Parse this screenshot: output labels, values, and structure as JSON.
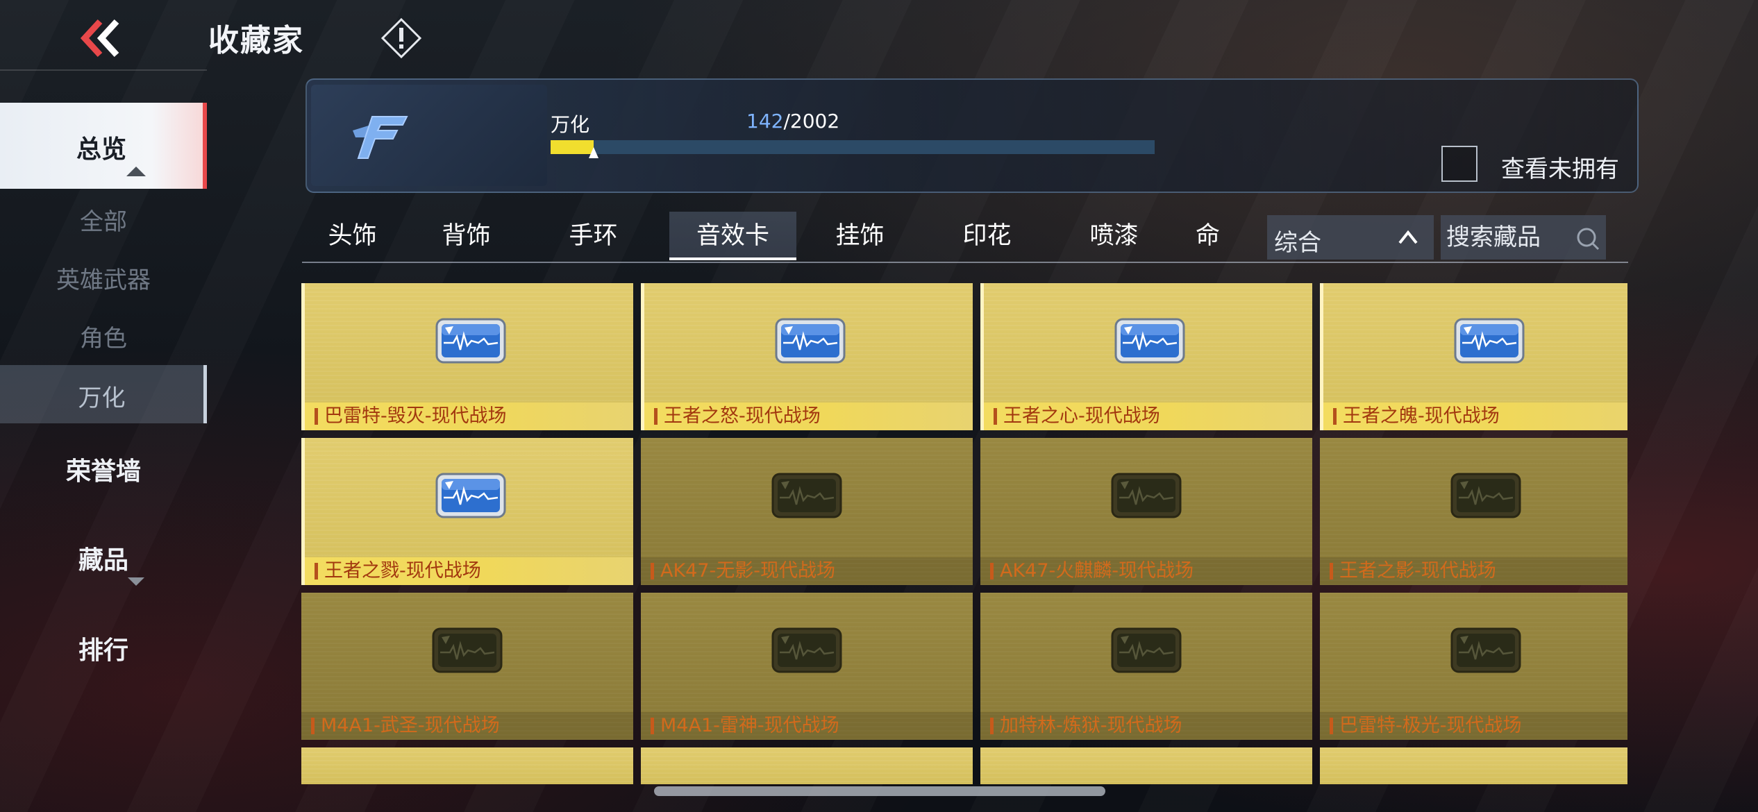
{
  "header": {
    "title": "收藏家"
  },
  "sidebar": {
    "overview_label": "总览",
    "sub_items": [
      {
        "label": "全部"
      },
      {
        "label": "英雄武器"
      },
      {
        "label": "角色"
      },
      {
        "label": "万化"
      }
    ],
    "selected_sub": "万化",
    "main_items": [
      {
        "label": "荣誉墙"
      },
      {
        "label": "藏品"
      },
      {
        "label": "排行"
      }
    ]
  },
  "progress": {
    "label": "万化",
    "current": "142",
    "total": "/2002",
    "fraction": 0.071
  },
  "owned_filter": {
    "label": "查看未拥有",
    "checked": false
  },
  "tabs": [
    {
      "label": "头饰"
    },
    {
      "label": "背饰"
    },
    {
      "label": "手环"
    },
    {
      "label": "音效卡"
    },
    {
      "label": "挂饰"
    },
    {
      "label": "印花"
    },
    {
      "label": "喷漆"
    },
    {
      "label": "命"
    }
  ],
  "active_tab": "音效卡",
  "sort": {
    "label": "综合"
  },
  "search": {
    "placeholder": "搜索藏品"
  },
  "items": [
    {
      "name": "巴雷特-毁灭-现代战场",
      "owned": true
    },
    {
      "name": "王者之怒-现代战场",
      "owned": true
    },
    {
      "name": "王者之心-现代战场",
      "owned": true
    },
    {
      "name": "王者之魄-现代战场",
      "owned": true
    },
    {
      "name": "王者之戮-现代战场",
      "owned": true
    },
    {
      "name": "AK47-无影-现代战场",
      "owned": false
    },
    {
      "name": "AK47-火麒麟-现代战场",
      "owned": false
    },
    {
      "name": "王者之影-现代战场",
      "owned": false
    },
    {
      "name": "M4A1-武圣-现代战场",
      "owned": false
    },
    {
      "name": "M4A1-雷神-现代战场",
      "owned": false
    },
    {
      "name": "加特林-炼狱-现代战场",
      "owned": false
    },
    {
      "name": "巴雷特-极光-现代战场",
      "owned": false
    }
  ],
  "icons": {
    "back": "double-chevron-left-icon",
    "info": "exclamation-diamond-icon",
    "logo": "cf-logo-icon",
    "sort_toggle": "chevron-up-icon",
    "search": "search-icon",
    "item": "sound-card-icon"
  },
  "colors": {
    "accent_red": "#e8484a",
    "progress_fill": "#f1de2e",
    "progress_count": "#7fb4ff",
    "owned_card": "#d8c463",
    "locked_card": "#928140",
    "item_name_owned": "#a2380f",
    "item_name_locked": "#d26a1c"
  }
}
